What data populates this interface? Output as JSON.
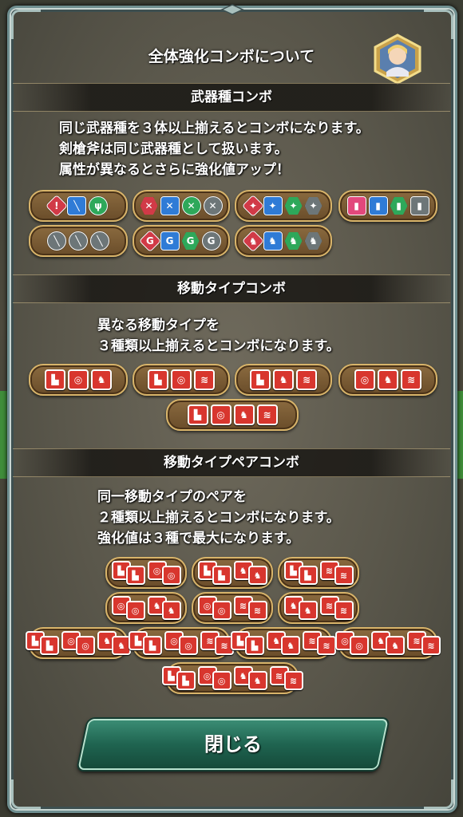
{
  "dialog": {
    "title": "全体強化コンボについて",
    "close_label": "閉じる"
  },
  "weapon_section": {
    "heading": "武器種コンボ",
    "lines": [
      "同じ武器種を３体以上揃えるとコンボになります。",
      "剣槍斧は同じ武器種として扱います。",
      "属性が異なるとさらに強化値アップ！"
    ],
    "combos": [
      {
        "icons": [
          "sword-red",
          "lance-blue",
          "axe-green"
        ]
      },
      {
        "icons": [
          "bow-red",
          "bow-blue",
          "bow-green",
          "bow-gray"
        ]
      },
      {
        "icons": [
          "dagger-red",
          "dagger-blue",
          "dagger-green",
          "dagger-gray"
        ]
      },
      {
        "icons": [
          "tome-red",
          "tome-blue",
          "tome-green",
          "tome-gray"
        ]
      },
      {
        "icons": [
          "staff-gray",
          "staff-gray",
          "staff-gray"
        ]
      },
      {
        "icons": [
          "breath-red",
          "breath-blue",
          "breath-green",
          "breath-gray"
        ]
      },
      {
        "icons": [
          "beast-red",
          "beast-blue",
          "beast-green",
          "beast-gray"
        ]
      }
    ]
  },
  "move_section": {
    "heading": "移動タイプコンボ",
    "lines": [
      "異なる移動タイプを",
      "３種類以上揃えるとコンボになります。"
    ],
    "combos": [
      {
        "icons": [
          "infantry",
          "armored",
          "cavalry"
        ]
      },
      {
        "icons": [
          "infantry",
          "armored",
          "flying"
        ]
      },
      {
        "icons": [
          "infantry",
          "cavalry",
          "flying"
        ]
      },
      {
        "icons": [
          "armored",
          "cavalry",
          "flying"
        ]
      },
      {
        "icons": [
          "infantry",
          "armored",
          "cavalry",
          "flying"
        ]
      }
    ]
  },
  "pair_section": {
    "heading": "移動タイプペアコンボ",
    "lines": [
      "同一移動タイプのペアを",
      "２種類以上揃えるとコンボになります。",
      "強化値は３種で最大になります。"
    ],
    "combos": [
      {
        "pairs": [
          "infantry",
          "armored"
        ]
      },
      {
        "pairs": [
          "infantry",
          "cavalry"
        ]
      },
      {
        "pairs": [
          "infantry",
          "flying"
        ]
      },
      {
        "pairs": [
          "armored",
          "cavalry"
        ]
      },
      {
        "pairs": [
          "armored",
          "flying"
        ]
      },
      {
        "pairs": [
          "cavalry",
          "flying"
        ]
      },
      {
        "pairs": [
          "infantry",
          "armored",
          "cavalry"
        ]
      },
      {
        "pairs": [
          "infantry",
          "armored",
          "flying"
        ]
      },
      {
        "pairs": [
          "infantry",
          "cavalry",
          "flying"
        ]
      },
      {
        "pairs": [
          "armored",
          "cavalry",
          "flying"
        ]
      },
      {
        "pairs": [
          "infantry",
          "armored",
          "cavalry",
          "flying"
        ]
      }
    ]
  }
}
